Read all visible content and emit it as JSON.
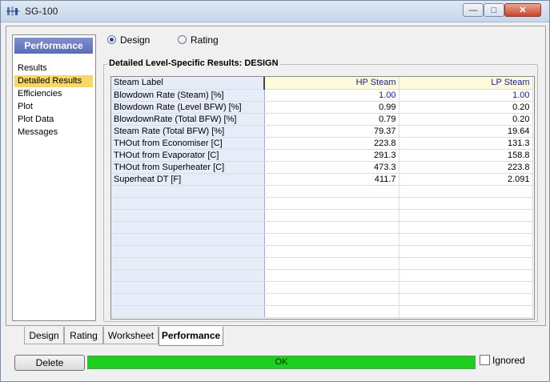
{
  "window": {
    "title": "SG-100",
    "buttons": {
      "minimize": "—",
      "maximize": "□",
      "close": "✕"
    }
  },
  "nav": {
    "header": "Performance",
    "items": [
      "Results",
      "Detailed Results",
      "Efficiencies",
      "Plot",
      "Plot Data",
      "Messages"
    ],
    "selected": "Detailed Results"
  },
  "mode": {
    "options": [
      {
        "label": "Design",
        "checked": true
      },
      {
        "label": "Rating",
        "checked": false
      }
    ]
  },
  "group": {
    "title": "Detailed Level-Specific Results: DESIGN"
  },
  "table": {
    "header": {
      "label": "Steam Label",
      "col1": "HP Steam",
      "col2": "LP Steam"
    },
    "rows": [
      {
        "label": "Blowdown Rate (Steam) [%]",
        "col1": "1.00",
        "col2": "1.00",
        "blue": true
      },
      {
        "label": "Blowdown Rate (Level BFW) [%]",
        "col1": "0.99",
        "col2": "0.20"
      },
      {
        "label": "BlowdownRate (Total BFW) [%]",
        "col1": "0.79",
        "col2": "0.20"
      },
      {
        "label": "Steam Rate (Total BFW) [%]",
        "col1": "79.37",
        "col2": "19.64"
      },
      {
        "label": "THOut from Economiser [C]",
        "col1": "223.8",
        "col2": "131.3"
      },
      {
        "label": "THOut from Evaporator [C]",
        "col1": "291.3",
        "col2": "158.8"
      },
      {
        "label": "THOut from Superheater [C]",
        "col1": "473.3",
        "col2": "223.8"
      },
      {
        "label": "Superheat DT [F]",
        "col1": "411.7",
        "col2": "2.091"
      }
    ]
  },
  "tabs": [
    "Design",
    "Rating",
    "Worksheet",
    "Performance"
  ],
  "active_tab": "Performance",
  "footer": {
    "delete_label": "Delete",
    "status_text": "OK",
    "status_color": "#1fce1f",
    "ignored_label": "Ignored",
    "ignored_checked": false
  },
  "colors": {
    "nav_header": "#5a6cb8",
    "nav_selected": "#f7d769",
    "value_blue": "#1a1a99"
  }
}
